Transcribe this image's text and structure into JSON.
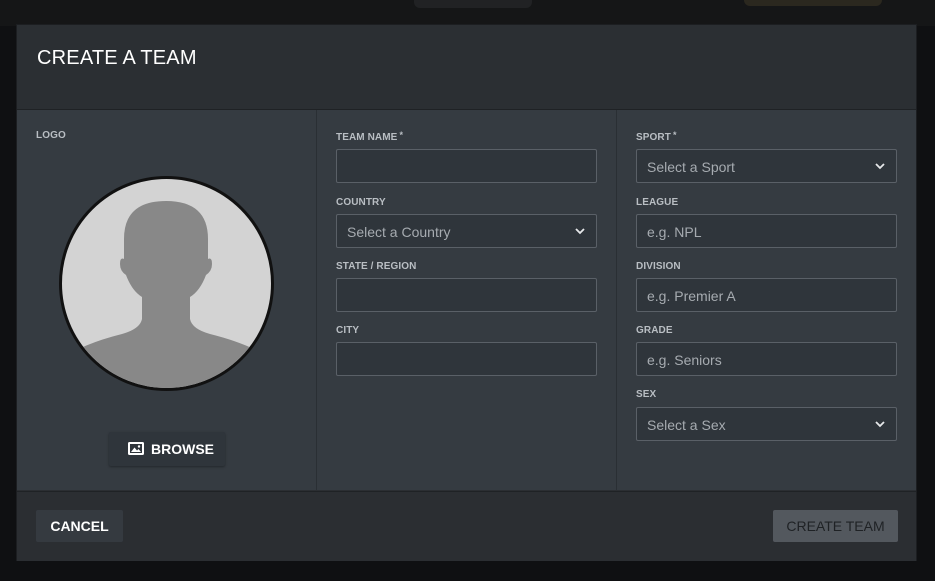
{
  "modal": {
    "title": "CREATE A TEAM"
  },
  "logo": {
    "label": "LOGO",
    "browse_label": "BROWSE",
    "browse_icon": "image-icon",
    "avatar_icon": "person-silhouette-icon"
  },
  "fields": {
    "team_name": {
      "label": "TEAM NAME",
      "required": "*",
      "value": ""
    },
    "country": {
      "label": "COUNTRY",
      "placeholder": "Select a Country"
    },
    "state": {
      "label": "STATE / REGION",
      "value": ""
    },
    "city": {
      "label": "CITY",
      "value": ""
    },
    "sport": {
      "label": "SPORT",
      "required": "*",
      "placeholder": "Select a Sport"
    },
    "league": {
      "label": "LEAGUE",
      "placeholder": "e.g. NPL"
    },
    "division": {
      "label": "DIVISION",
      "placeholder": "e.g. Premier A"
    },
    "grade": {
      "label": "GRADE",
      "placeholder": "e.g. Seniors"
    },
    "sex": {
      "label": "SEX",
      "placeholder": "Select a Sex"
    }
  },
  "footer": {
    "cancel_label": "CANCEL",
    "create_label": "CREATE TEAM"
  },
  "colors": {
    "modal_bg": "#2b2e32",
    "body_bg": "#353b41",
    "input_border": "#5a6067",
    "create_button_bg": "#53585e"
  }
}
